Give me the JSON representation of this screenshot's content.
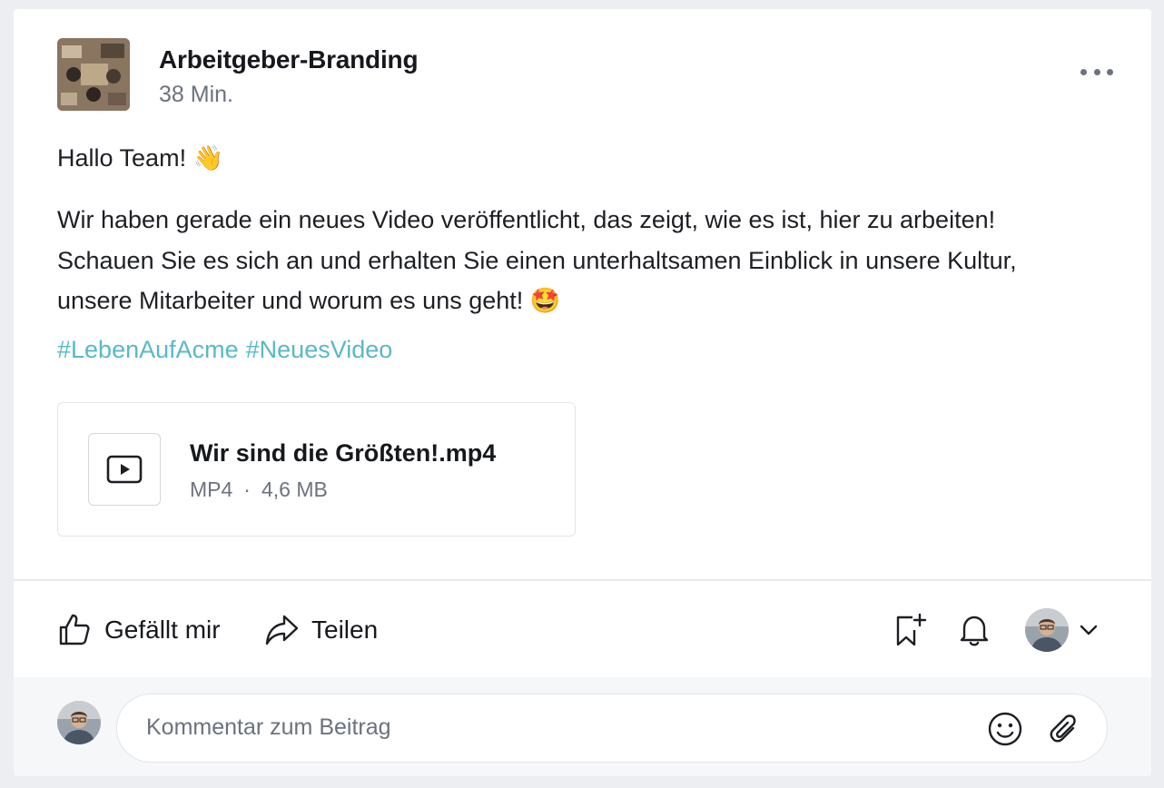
{
  "post": {
    "author": "Arbeitgeber-Branding",
    "time": "38 Min.",
    "greeting": "Hallo Team! 👋",
    "message_line1": "Wir haben gerade ein neues Video veröffentlicht, das zeigt, wie es ist, hier zu arbeiten!",
    "message_line2": "Schauen Sie es sich an und erhalten Sie einen unterhaltsamen Einblick in unsere Kultur,",
    "message_line3": "unsere Mitarbeiter und worum es uns geht! 🤩",
    "hashtags": [
      "#LebenAufAcme",
      "#NeuesVideo"
    ]
  },
  "attachment": {
    "name": "Wir sind die Größten!.mp4",
    "type": "MP4",
    "separator": "·",
    "size": "4,6 MB",
    "icon": "video-play-icon"
  },
  "actions": {
    "like_label": "Gefällt mir",
    "share_label": "Teilen"
  },
  "comment": {
    "placeholder": "Kommentar zum Beitrag"
  },
  "colors": {
    "hashtag": "#5ab8c8",
    "muted_text": "#6b7280",
    "background": "#eceef2"
  }
}
